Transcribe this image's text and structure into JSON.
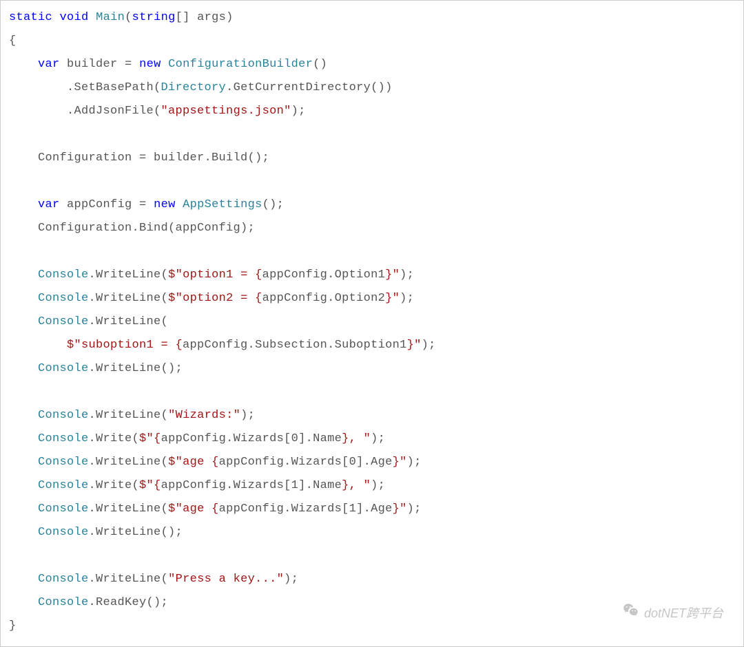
{
  "code": {
    "t1_a": "static",
    "t1_b": "void",
    "t1_c": "Main",
    "t1_d": "(",
    "t1_e": "string",
    "t1_f": "[] args)",
    "t2": "{",
    "t3_a": "    ",
    "t3_b": "var",
    "t3_c": " builder = ",
    "t3_d": "new",
    "t3_e": " ",
    "t3_f": "ConfigurationBuilder",
    "t3_g": "()",
    "t4_a": "        .SetBasePath(",
    "t4_b": "Directory",
    "t4_c": ".GetCurrentDirectory())",
    "t5_a": "        .AddJsonFile(",
    "t5_b": "\"appsettings.json\"",
    "t5_c": ");",
    "t6": "",
    "t7": "    Configuration = builder.Build();",
    "t8": "",
    "t9_a": "    ",
    "t9_b": "var",
    "t9_c": " appConfig = ",
    "t9_d": "new",
    "t9_e": " ",
    "t9_f": "AppSettings",
    "t9_g": "();",
    "t10": "    Configuration.Bind(appConfig);",
    "t11": "",
    "t12_a": "    ",
    "t12_b": "Console",
    "t12_c": ".WriteLine(",
    "t12_d": "$\"option1 = {",
    "t12_e": "appConfig.Option1",
    "t12_f": "}\"",
    "t12_g": ");",
    "t13_a": "    ",
    "t13_b": "Console",
    "t13_c": ".WriteLine(",
    "t13_d": "$\"option2 = {",
    "t13_e": "appConfig.Option2",
    "t13_f": "}\"",
    "t13_g": ");",
    "t14_a": "    ",
    "t14_b": "Console",
    "t14_c": ".WriteLine(",
    "t15_a": "        ",
    "t15_b": "$\"suboption1 = {",
    "t15_c": "appConfig.Subsection.Suboption1",
    "t15_d": "}\"",
    "t15_e": ");",
    "t16_a": "    ",
    "t16_b": "Console",
    "t16_c": ".WriteLine();",
    "t17": "",
    "t18_a": "    ",
    "t18_b": "Console",
    "t18_c": ".WriteLine(",
    "t18_d": "\"Wizards:\"",
    "t18_e": ");",
    "t19_a": "    ",
    "t19_b": "Console",
    "t19_c": ".Write(",
    "t19_d": "$\"{",
    "t19_e": "appConfig.Wizards[0].Name",
    "t19_f": "}, \"",
    "t19_g": ");",
    "t20_a": "    ",
    "t20_b": "Console",
    "t20_c": ".WriteLine(",
    "t20_d": "$\"age {",
    "t20_e": "appConfig.Wizards[0].Age",
    "t20_f": "}\"",
    "t20_g": ");",
    "t21_a": "    ",
    "t21_b": "Console",
    "t21_c": ".Write(",
    "t21_d": "$\"{",
    "t21_e": "appConfig.Wizards[1].Name",
    "t21_f": "}, \"",
    "t21_g": ");",
    "t22_a": "    ",
    "t22_b": "Console",
    "t22_c": ".WriteLine(",
    "t22_d": "$\"age {",
    "t22_e": "appConfig.Wizards[1].Age",
    "t22_f": "}\"",
    "t22_g": ");",
    "t23_a": "    ",
    "t23_b": "Console",
    "t23_c": ".WriteLine();",
    "t24": "",
    "t25_a": "    ",
    "t25_b": "Console",
    "t25_c": ".WriteLine(",
    "t25_d": "\"Press a key...\"",
    "t25_e": ");",
    "t26_a": "    ",
    "t26_b": "Console",
    "t26_c": ".ReadKey();",
    "t27": "}"
  },
  "watermark": "dotNET跨平台"
}
